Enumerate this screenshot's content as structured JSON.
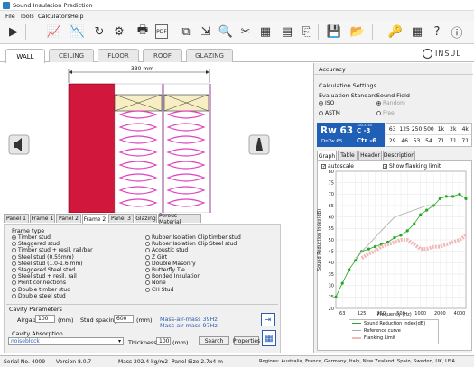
{
  "window_title": "Sound Insulation Prediction",
  "menu": [
    "File",
    "Tools",
    "Calculators",
    "Help"
  ],
  "brand": "INSUL",
  "main_tabs": [
    "WALL",
    "CEILING",
    "FLOOR",
    "ROOF",
    "GLAZING"
  ],
  "dimension_label": "330 mm",
  "frame_tabs": [
    "Panel 1",
    "Frame 1",
    "Panel 2",
    "Frame 2",
    "Panel 3",
    "Glazing",
    "Porous Material"
  ],
  "frame_type": {
    "title": "Frame type",
    "left_options": [
      "Timber stud",
      "Staggered stud",
      "Timber stud + resil. rail/bar",
      "Steel stud (0.55mm)",
      "Steel stud (1.0-1.6 mm)",
      "Staggered Steel stud",
      "Steel stud + resil. rail",
      "Point connections",
      "Double timber stud",
      "Double steel stud"
    ],
    "right_options": [
      "Rubber Isolation Clip timber stud",
      "Rubber Isolation Clip Steel stud",
      "Acoustic stud",
      "Z Girt",
      "Double Masonry",
      "Butterfly Tie",
      "Bonded Insulation",
      "None",
      "CH Stud"
    ],
    "selected": "Timber stud"
  },
  "cavity": {
    "title": "Cavity Parameters",
    "airgap_label": "Airgap",
    "airgap_value": "100",
    "airgap_unit": "(mm)",
    "stud_spacing_label": "Stud spacing",
    "stud_spacing_value": "600",
    "stud_spacing_unit": "(mm)",
    "mass_air_mass_1": "Mass-air-mass 39Hz",
    "mass_air_mass_2": "Mass-air-mass 97Hz",
    "absorption_label": "Cavity Absorption",
    "absorption_value": "noiseblock",
    "thickness_label": "Thickness",
    "thickness_value": "100",
    "thickness_unit": "(mm)",
    "search_button": "Search",
    "properties_button": "Properties"
  },
  "accuracy_label": "Accuracy",
  "calc_settings": {
    "title": "Calculation Settings",
    "eval_label": "Evaluation Standard",
    "eval_options": [
      "ISO",
      "ASTM"
    ],
    "eval_selected": "ISO",
    "field_label": "Sound Field",
    "field_options": [
      "Random",
      "Free"
    ],
    "field_selected": "Random"
  },
  "rating": {
    "rw": "Rw 63",
    "dntw": "DnTw 65",
    "c": "C -3",
    "ctr": "Ctr -6",
    "c_range": "100-3150",
    "freqs": [
      "63",
      "125",
      "250",
      "500",
      "1k",
      "2k",
      "4k"
    ],
    "values": [
      "29",
      "46",
      "53",
      "54",
      "71",
      "71",
      "71"
    ]
  },
  "result_tabs": [
    "Graph",
    "Table",
    "Header",
    "Description"
  ],
  "autoscale_label": "autoscale",
  "flanking_label": "Show flanking limit",
  "chart_data": {
    "type": "line",
    "xlabel": "Frequency (Hz)",
    "ylabel": "Sound Reduction Index(dB)",
    "x_scale": "log",
    "xlim": [
      50,
      5000
    ],
    "ylim": [
      20,
      80
    ],
    "x_ticks": [
      "63",
      "125",
      "250",
      "500",
      "1000",
      "2000",
      "4000"
    ],
    "y_ticks": [
      20,
      25,
      30,
      35,
      40,
      45,
      50,
      55,
      60,
      65,
      70,
      75,
      80
    ],
    "x": [
      50,
      63,
      80,
      100,
      125,
      160,
      200,
      250,
      315,
      400,
      500,
      630,
      800,
      1000,
      1250,
      1600,
      2000,
      2500,
      3150,
      4000,
      5000
    ],
    "series": [
      {
        "name": "Sound Reduction Index(dB)",
        "color": "#22aa22",
        "values": [
          25,
          31,
          37,
          41,
          45,
          46,
          47,
          48,
          49,
          51,
          52,
          54,
          57,
          61,
          63,
          65,
          68,
          69,
          69,
          70,
          68
        ]
      },
      {
        "name": "Reference curve",
        "color": "#aaaaaa",
        "values": [
          null,
          null,
          null,
          42,
          45,
          48,
          51,
          54,
          57,
          60,
          61,
          62,
          63,
          64,
          65,
          65,
          65,
          65,
          65,
          null,
          null
        ]
      },
      {
        "name": "Flanking Limit",
        "color": "#f2b8b8",
        "values": [
          null,
          null,
          null,
          null,
          42,
          44,
          45,
          47,
          48,
          49,
          50,
          50,
          48,
          46,
          46,
          47,
          47,
          48,
          49,
          50,
          52
        ]
      }
    ],
    "legend": "bottom"
  },
  "status": {
    "serial": "Serial No. 4009",
    "version": "Version  8.0.7",
    "mass": "Mass 202.4 kg/m2",
    "panel_size": "Panel Size 2.7x4 m",
    "regions": "Regions: Australia, France, Germany, Italy, New Zealand, Spain, Sweden, UK, USA"
  }
}
